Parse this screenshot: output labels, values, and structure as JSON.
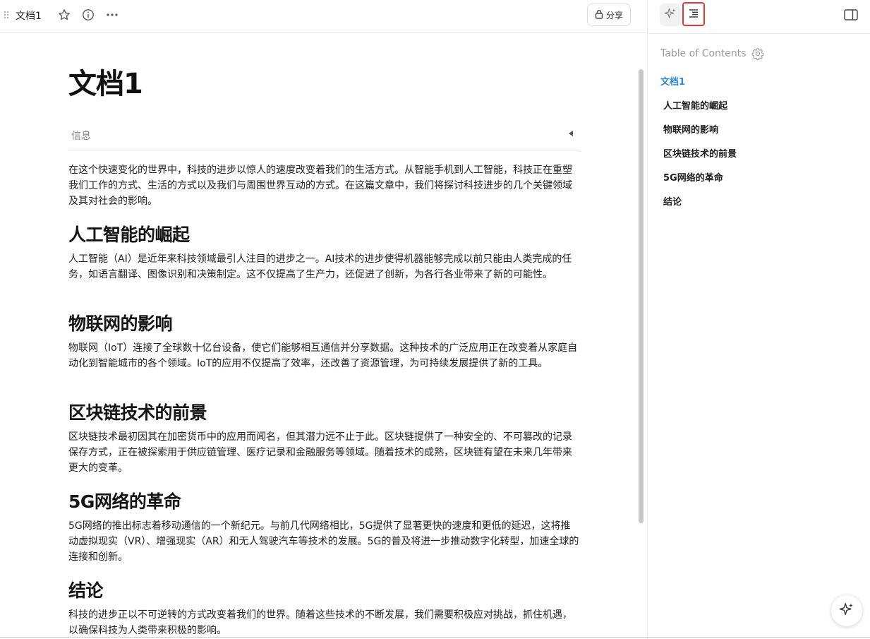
{
  "header": {
    "doc_title": "文档1",
    "share_label": "分享"
  },
  "document": {
    "title": "文档1",
    "info_label": "信息",
    "intro": "在这个快速变化的世界中，科技的进步以惊人的速度改变着我们的生活方式。从智能手机到人工智能，科技正在重塑我们工作的方式、生活的方式以及我们与周围世界互动的方式。在这篇文章中，我们将探讨科技进步的几个关键领域及其对社会的影响。",
    "sections": [
      {
        "heading": "人工智能的崛起",
        "body": "人工智能（AI）是近年来科技领域最引人注目的进步之一。AI技术的进步使得机器能够完成以前只能由人类完成的任务，如语言翻译、图像识别和决策制定。这不仅提高了生产力，还促进了创新，为各行各业带来了新的可能性。"
      },
      {
        "heading": "物联网的影响",
        "body": "物联网（IoT）连接了全球数十亿台设备，使它们能够相互通信并分享数据。这种技术的广泛应用正在改变着从家庭自动化到智能城市的各个领域。IoT的应用不仅提高了效率，还改善了资源管理，为可持续发展提供了新的工具。"
      },
      {
        "heading": "区块链技术的前景",
        "body": "区块链技术最初因其在加密货币中的应用而闻名，但其潜力远不止于此。区块链提供了一种安全的、不可篡改的记录保存方式，正在被探索用于供应链管理、医疗记录和金融服务等领域。随着技术的成熟，区块链有望在未来几年带来更大的变革。"
      },
      {
        "heading": "5G网络的革命",
        "body": "5G网络的推出标志着移动通信的一个新纪元。与前几代网络相比，5G提供了显著更快的速度和更低的延迟，这将推动虚拟现实（VR）、增强现实（AR）和无人驾驶汽车等技术的发展。5G的普及将进一步推动数字化转型，加速全球的连接和创新。"
      },
      {
        "heading": "结论",
        "body": "科技的进步正以不可逆转的方式改变着我们的世界。随着这些技术的不断发展，我们需要积极应对挑战，抓住机遇，以确保科技为人类带来积极的影响。"
      }
    ]
  },
  "toc": {
    "title": "Table of Contents",
    "items": [
      {
        "label": "文档1",
        "active": true
      },
      {
        "label": "人工智能的崛起",
        "active": false
      },
      {
        "label": "物联网的影响",
        "active": false
      },
      {
        "label": "区块链技术的前景",
        "active": false
      },
      {
        "label": "5G网络的革命",
        "active": false
      },
      {
        "label": "结论",
        "active": false
      }
    ]
  },
  "colors": {
    "accent": "#2b88d9",
    "highlight_border": "#e53935"
  },
  "icons": [
    "drag-handle-icon",
    "star-icon",
    "info-icon",
    "more-icon",
    "lock-icon",
    "sparkle-icon",
    "toc-icon",
    "side-panel-icon",
    "gear-icon"
  ]
}
